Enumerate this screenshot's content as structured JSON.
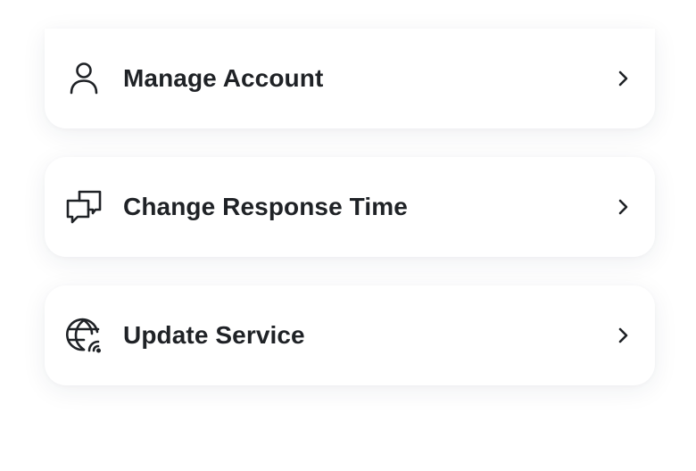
{
  "menu": {
    "items": [
      {
        "label": "Manage Account",
        "icon": "user-icon"
      },
      {
        "label": "Change Response Time",
        "icon": "chat-bubbles-icon"
      },
      {
        "label": "Update Service",
        "icon": "globe-wifi-icon"
      }
    ]
  },
  "colors": {
    "text": "#1f2226",
    "icon": "#1f2226",
    "card": "#ffffff"
  }
}
